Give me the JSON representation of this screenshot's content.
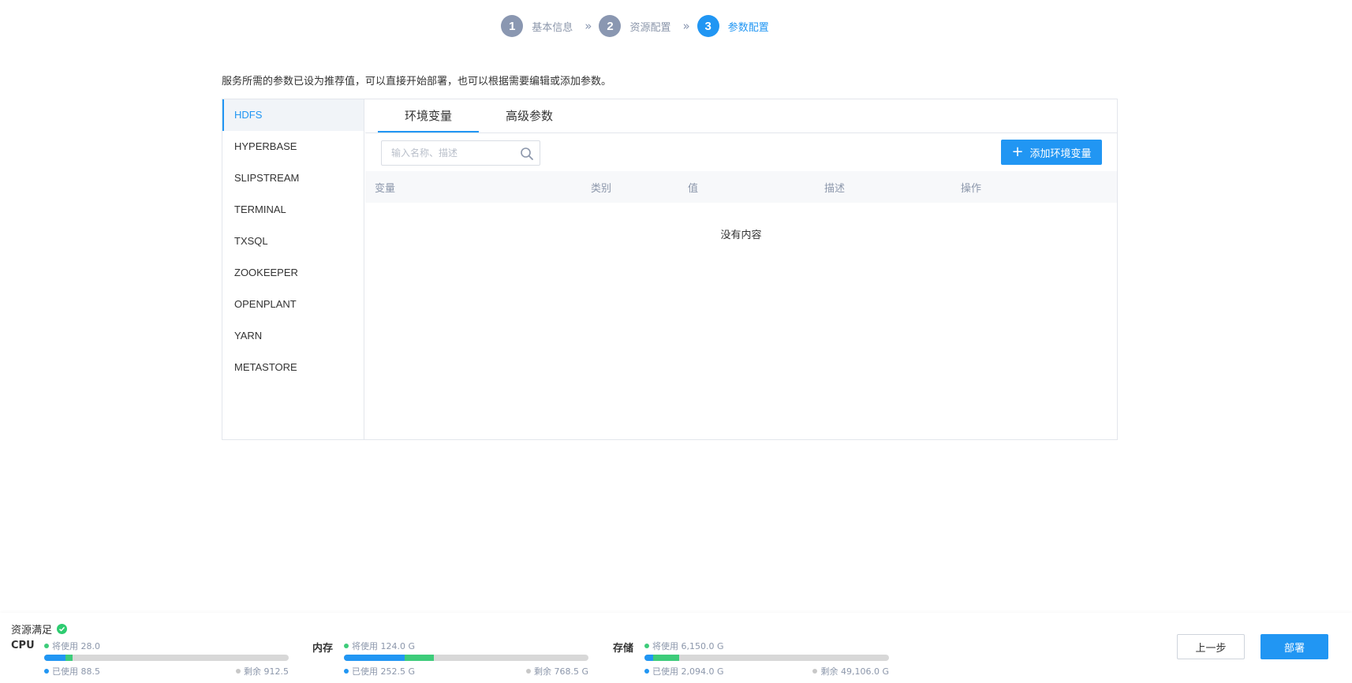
{
  "stepper": {
    "steps": [
      {
        "num": "1",
        "label": "基本信息"
      },
      {
        "num": "2",
        "label": "资源配置"
      },
      {
        "num": "3",
        "label": "参数配置"
      }
    ],
    "separator": "»",
    "active_step": 3
  },
  "hint": "服务所需的参数已设为推荐值，可以直接开始部署，也可以根据需要编辑或添加参数。",
  "services": [
    "HDFS",
    "HYPERBASE",
    "SLIPSTREAM",
    "TERMINAL",
    "TXSQL",
    "ZOOKEEPER",
    "OPENPLANT",
    "YARN",
    "METASTORE"
  ],
  "active_service": "HDFS",
  "tabs": [
    "环境变量",
    "高级参数"
  ],
  "active_tab": "环境变量",
  "search": {
    "placeholder": "输入名称、描述",
    "value": ""
  },
  "add_button": "添加环境变量",
  "table": {
    "columns": [
      "变量",
      "类别",
      "值",
      "描述",
      "操作"
    ],
    "empty_text": "没有内容"
  },
  "footer": {
    "status": "资源满足",
    "resources": [
      {
        "name": "CPU",
        "will_use": "将使用 28.0",
        "used": "已使用 88.5",
        "remaining": "剩余 912.5",
        "used_fraction": 0.0885,
        "will_fraction": 0.028
      },
      {
        "name": "内存",
        "will_use": "将使用 124.0 G",
        "used": "已使用 252.5 G",
        "remaining": "剩余 768.5 G",
        "used_fraction": 0.2472,
        "will_fraction": 0.1214
      },
      {
        "name": "存储",
        "will_use": "将使用 6,150.0 G",
        "used": "已使用 2,094.0 G",
        "remaining": "剩余 49,106.0 G",
        "used_fraction": 0.0364,
        "will_fraction": 0.1068
      }
    ],
    "prev_button": "上一步",
    "deploy_button": "部署"
  },
  "colors": {
    "accent": "#2196f3",
    "success": "#3dcc7a",
    "step_inactive": "#8a97b1"
  }
}
